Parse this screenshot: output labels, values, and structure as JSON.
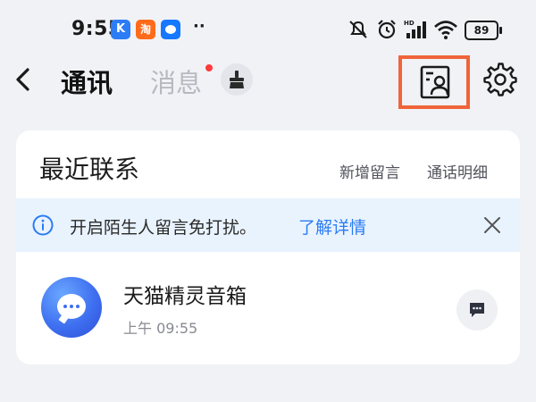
{
  "status_bar": {
    "time": "9:55",
    "app_badge_k": "K",
    "app_badge_taobao": "淘",
    "dots": "··",
    "battery": "89"
  },
  "header": {
    "tab_contacts": "通讯",
    "tab_messages": "消息",
    "messages_has_dot": true
  },
  "card": {
    "title": "最近联系",
    "link_new_message": "新增留言",
    "link_call_detail": "通话明细"
  },
  "notice": {
    "text": "开启陌生人留言免打扰。",
    "link": "了解详情"
  },
  "contacts": [
    {
      "name": "天猫精灵音箱",
      "time": "上午 09:55"
    }
  ],
  "colors": {
    "accent": "#2b7cf5",
    "highlight_box": "#f0643a",
    "red_dot": "#ff3b3b",
    "notice_bg": "#e9f3fe"
  }
}
